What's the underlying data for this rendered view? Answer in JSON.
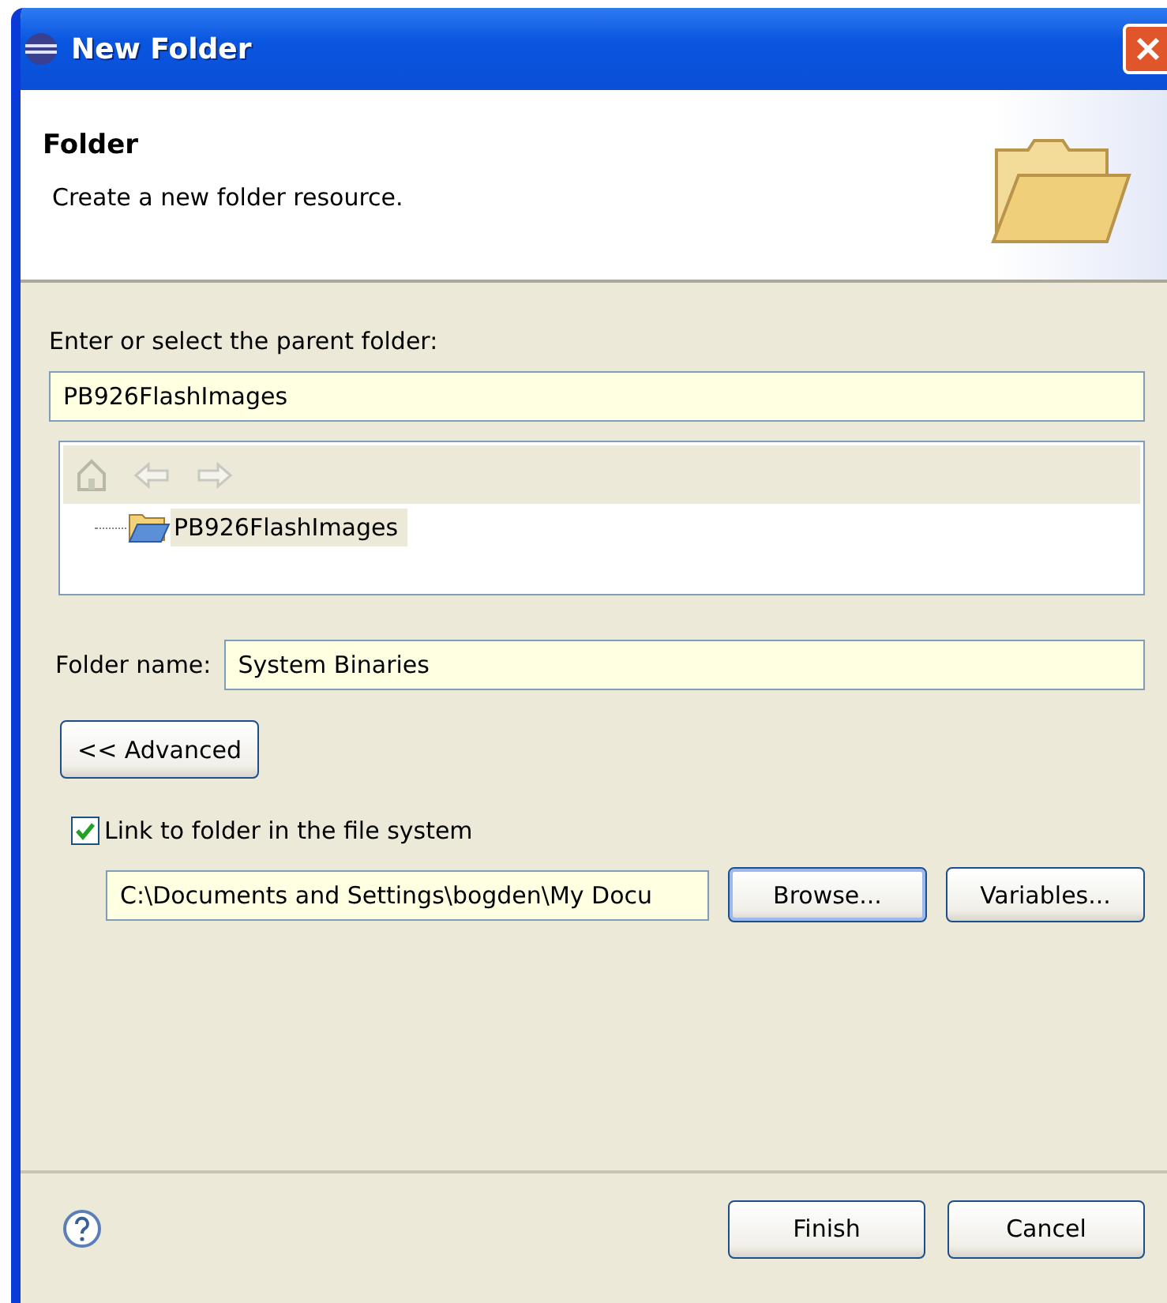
{
  "window": {
    "title": "New Folder"
  },
  "header": {
    "title": "Folder",
    "description": "Create a new folder resource."
  },
  "parent": {
    "label": "Enter or select the parent folder:",
    "value": "PB926FlashImages"
  },
  "tree": {
    "items": [
      {
        "label": "PB926FlashImages",
        "selected": true
      }
    ]
  },
  "folder_name": {
    "label": "Folder name:",
    "value": "System Binaries"
  },
  "advanced_button": "<< Advanced",
  "link": {
    "label": "Link to folder in the file system",
    "checked": true,
    "path": "C:\\Documents and Settings\\bogden\\My Docu",
    "buttons": [
      "Browse...",
      "Variables..."
    ]
  },
  "footer_buttons": [
    "Finish",
    "Cancel"
  ]
}
